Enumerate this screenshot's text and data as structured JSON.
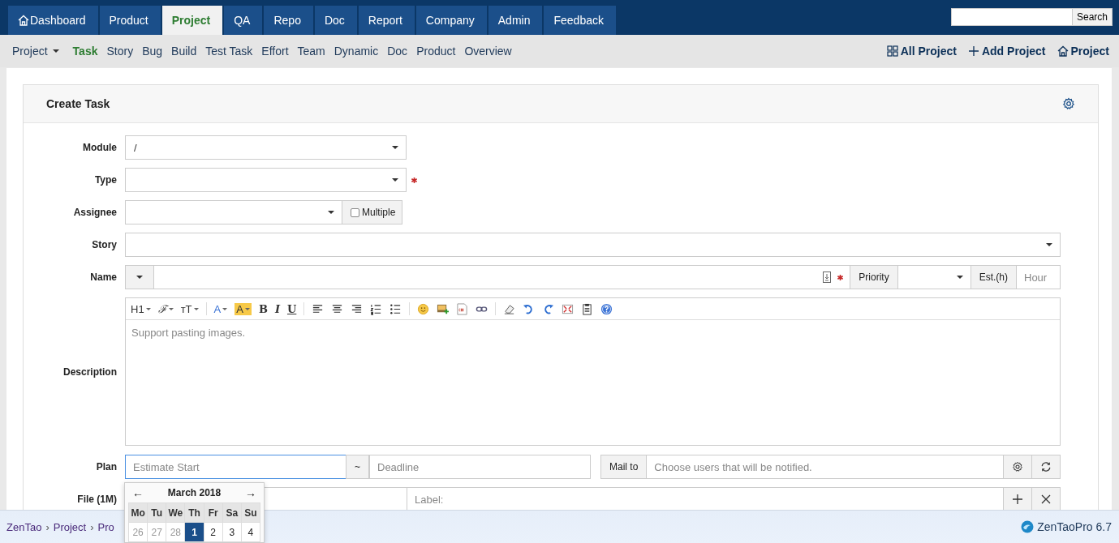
{
  "nav": {
    "tabs": [
      {
        "label": "Dashboard",
        "kind": "home",
        "selected": false
      },
      {
        "label": "Product",
        "kind": "plain",
        "selected": false
      },
      {
        "label": "Project",
        "kind": "plain",
        "selected": true
      },
      {
        "label": "QA",
        "kind": "plain",
        "selected": false
      },
      {
        "label": "Repo",
        "kind": "plain",
        "selected": false
      },
      {
        "label": "Doc",
        "kind": "plain",
        "selected": false
      },
      {
        "label": "Report",
        "kind": "plain",
        "selected": false
      },
      {
        "label": "Company",
        "kind": "plain",
        "selected": false
      },
      {
        "label": "Admin",
        "kind": "plain",
        "selected": false
      },
      {
        "label": "Feedback",
        "kind": "plain",
        "selected": false
      }
    ],
    "search": {
      "button": "Search"
    }
  },
  "subnav": {
    "menu": "Project",
    "items": [
      {
        "label": "Task",
        "selected": true
      },
      {
        "label": "Story",
        "selected": false
      },
      {
        "label": "Bug",
        "selected": false
      },
      {
        "label": "Build",
        "selected": false
      },
      {
        "label": "Test Task",
        "selected": false
      },
      {
        "label": "Effort",
        "selected": false
      },
      {
        "label": "Team",
        "selected": false
      },
      {
        "label": "Dynamic",
        "selected": false
      },
      {
        "label": "Doc",
        "selected": false
      },
      {
        "label": "Product",
        "selected": false
      },
      {
        "label": "Overview",
        "selected": false
      }
    ],
    "actions": [
      {
        "label": "All Project",
        "kind": "grid"
      },
      {
        "label": "Add Project",
        "kind": "plus"
      },
      {
        "label": "Project",
        "kind": "home"
      }
    ]
  },
  "panel": {
    "title": "Create Task"
  },
  "form": {
    "module": {
      "label": "Module",
      "value": "/"
    },
    "type": {
      "label": "Type",
      "required": true
    },
    "assignee": {
      "label": "Assignee",
      "multiple": {
        "label": "Multiple",
        "checked": false
      }
    },
    "story": {
      "label": "Story"
    },
    "name": {
      "label": "Name",
      "required": true,
      "priority": "Priority",
      "estimate": "Est.(h)",
      "estimate_placeholder": "Hour"
    },
    "description": {
      "label": "Description",
      "placeholder": "Support pasting images.",
      "toolbar": [
        {
          "kind": "heading",
          "label": "H1"
        },
        {
          "kind": "font",
          "label": "ℱ"
        },
        {
          "kind": "size",
          "label": "ᴛT"
        },
        {
          "kind": "sep"
        },
        {
          "kind": "color",
          "label": "A"
        },
        {
          "kind": "highlight",
          "label": "A"
        },
        {
          "kind": "bold",
          "label": "B"
        },
        {
          "kind": "italic",
          "label": "I"
        },
        {
          "kind": "underline",
          "label": "U"
        },
        {
          "kind": "sep"
        },
        {
          "kind": "align-left"
        },
        {
          "kind": "align-center"
        },
        {
          "kind": "align-right"
        },
        {
          "kind": "ordered-list"
        },
        {
          "kind": "unordered-list"
        },
        {
          "kind": "sep"
        },
        {
          "kind": "emoji"
        },
        {
          "kind": "image"
        },
        {
          "kind": "code"
        },
        {
          "kind": "link"
        },
        {
          "kind": "sep"
        },
        {
          "kind": "eraser"
        },
        {
          "kind": "undo"
        },
        {
          "kind": "redo"
        },
        {
          "kind": "fullscreen"
        },
        {
          "kind": "paste"
        },
        {
          "kind": "help"
        }
      ]
    },
    "plan": {
      "label": "Plan",
      "start_placeholder": "Estimate Start",
      "separator": "~",
      "deadline_placeholder": "Deadline",
      "mail_label": "Mail to",
      "mail_placeholder": "Choose users that will be notified."
    },
    "file": {
      "label": "File (1M)",
      "label_placeholder": "Label:"
    }
  },
  "calendar": {
    "title": "March 2018",
    "prev": "←",
    "next": "→",
    "weekdays": [
      "Mo",
      "Tu",
      "We",
      "Th",
      "Fr",
      "Sa",
      "Su"
    ],
    "days": [
      {
        "label": "26",
        "muted": true,
        "selected": false
      },
      {
        "label": "27",
        "muted": true,
        "selected": false
      },
      {
        "label": "28",
        "muted": true,
        "selected": false
      },
      {
        "label": "1",
        "muted": false,
        "selected": true
      },
      {
        "label": "2",
        "muted": false,
        "selected": false
      },
      {
        "label": "3",
        "muted": false,
        "selected": false
      },
      {
        "label": "4",
        "muted": false,
        "selected": false
      }
    ]
  },
  "footer": {
    "breadcrumb": [
      "ZenTao",
      "Project",
      "Pro"
    ],
    "separator": "›",
    "version": "ZenTaoPro 6.7"
  }
}
